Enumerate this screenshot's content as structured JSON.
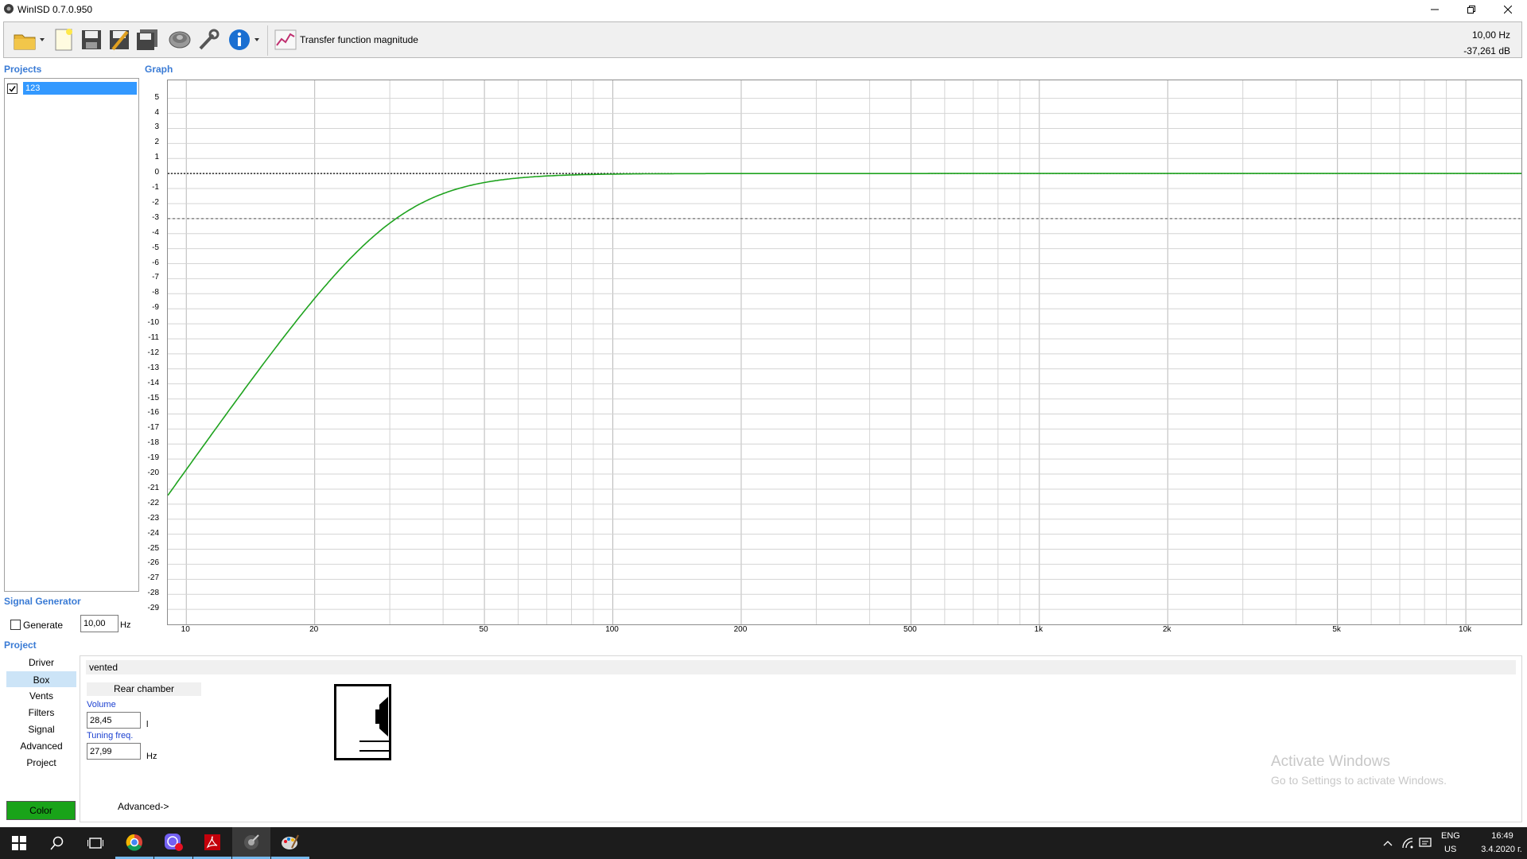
{
  "window": {
    "title": "WinISD 0.7.0.950"
  },
  "toolbar": {
    "graph_selector_label": "Transfer function magnitude",
    "readout_freq": "10,00 Hz",
    "readout_db": "-37,261 dB"
  },
  "projects_panel": {
    "label": "Projects",
    "items": [
      {
        "name": "123",
        "checked": true
      }
    ]
  },
  "graph_panel": {
    "label": "Graph",
    "y_ticks": [
      "5",
      "4",
      "3",
      "2",
      "1",
      "0",
      "-1",
      "-2",
      "-3",
      "-4",
      "-5",
      "-6",
      "-7",
      "-8",
      "-9",
      "-10",
      "-11",
      "-12",
      "-13",
      "-14",
      "-15",
      "-16",
      "-17",
      "-18",
      "-19",
      "-20",
      "-21",
      "-22",
      "-23",
      "-24",
      "-25",
      "-26",
      "-27",
      "-28",
      "-29"
    ],
    "x_ticks": [
      "10",
      "20",
      "50",
      "100",
      "200",
      "500",
      "1k",
      "2k",
      "5k",
      "10k"
    ],
    "curve_color": "#1fa31f",
    "reference_line_0db": "dotted",
    "reference_line_minus3db": "dashed"
  },
  "signal_generator": {
    "label": "Signal Generator",
    "generate_label": "Generate",
    "generate_checked": false,
    "freq_value": "10,00",
    "freq_unit": "Hz"
  },
  "project_section": {
    "label": "Project",
    "nav": [
      "Driver",
      "Box",
      "Vents",
      "Filters",
      "Signal",
      "Advanced",
      "Project"
    ],
    "active_nav": "Box",
    "color_button": "Color",
    "color_value": "#19a319"
  },
  "box_panel": {
    "box_type": "vented",
    "rear_chamber_label": "Rear chamber",
    "volume_label": "Volume",
    "volume_value": "28,45",
    "volume_unit": "l",
    "tuning_label": "Tuning freq.",
    "tuning_value": "27,99",
    "tuning_unit": "Hz",
    "advanced_link": "Advanced->"
  },
  "watermark": {
    "line1": "Activate Windows",
    "line2": "Go to Settings to activate Windows."
  },
  "taskbar": {
    "lang": "ENG",
    "region": "US",
    "time": "16:49",
    "date": "3.4.2020 г.",
    "apps": [
      "start-button",
      "search-icon",
      "task-view-icon",
      "chrome-icon",
      "viber-icon",
      "acrobat-icon",
      "winisd-icon",
      "paint-icon"
    ]
  }
}
